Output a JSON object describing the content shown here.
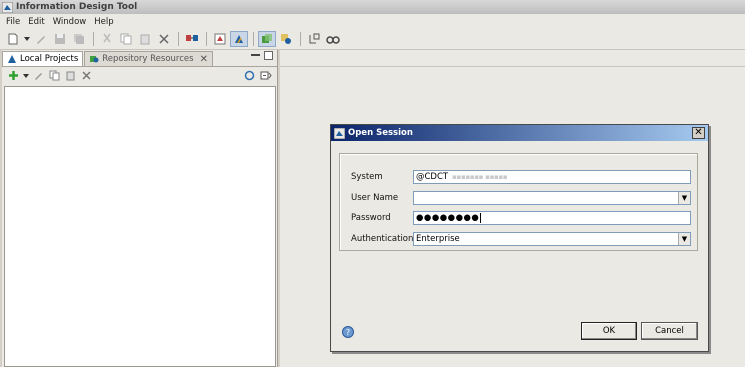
{
  "window": {
    "title": "Information Design Tool"
  },
  "menu": {
    "items": [
      "File",
      "Edit",
      "Window",
      "Help"
    ]
  },
  "left_panel": {
    "tabs": [
      {
        "label": "Local Projects",
        "active": true
      },
      {
        "label": "Repository Resources",
        "active": false
      }
    ],
    "close_glyph": "✕"
  },
  "dialog": {
    "title": "Open Session",
    "close_glyph": "✕",
    "fields": {
      "system": {
        "label": "System",
        "value": "@CDCT"
      },
      "username": {
        "label": "User Name",
        "value": ""
      },
      "password": {
        "label": "Password",
        "value": "●●●●●●●●"
      },
      "authentication": {
        "label": "Authentication",
        "value": "Enterprise"
      }
    },
    "buttons": {
      "ok": "OK",
      "cancel": "Cancel"
    }
  },
  "icons": {
    "new": "new-file-icon",
    "open": "open-icon",
    "save": "save-icon",
    "save_all": "save-all-icon",
    "cut": "cut-icon",
    "copy": "copy-icon",
    "paste": "paste-icon",
    "delete": "delete-icon",
    "help": "help-icon"
  },
  "colors": {
    "dialog_title_start": "#0a246a",
    "dialog_title_end": "#a6caf0"
  }
}
